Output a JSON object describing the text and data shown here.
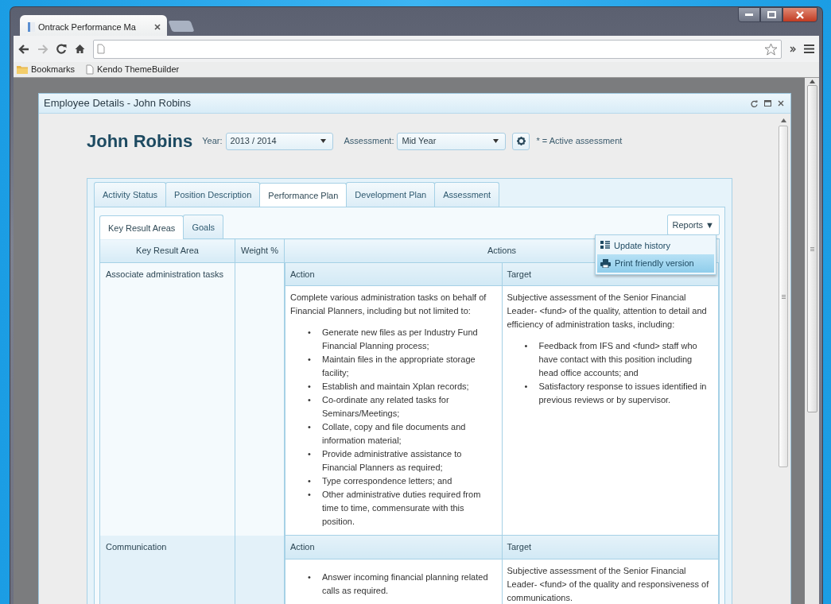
{
  "browser": {
    "tab_title": "Ontrack Performance Ma",
    "bookmarks": [
      {
        "kind": "folder",
        "label": "Bookmarks"
      },
      {
        "kind": "page",
        "label": "Kendo ThemeBuilder"
      }
    ]
  },
  "dialog": {
    "title": "Employee Details - John Robins"
  },
  "employee": {
    "name": "John Robins",
    "year_label": "Year:",
    "year": "2013 / 2014",
    "assessment_label": "Assessment:",
    "assessment": "Mid Year",
    "note": "* = Active assessment"
  },
  "tabs": [
    {
      "label": "Activity Status",
      "selected": false
    },
    {
      "label": "Position Description",
      "selected": false
    },
    {
      "label": "Performance Plan",
      "selected": true
    },
    {
      "label": "Development Plan",
      "selected": false
    },
    {
      "label": "Assessment",
      "selected": false
    }
  ],
  "subtabs": [
    {
      "label": "Key Result Areas",
      "selected": true
    },
    {
      "label": "Goals",
      "selected": false
    }
  ],
  "reports": {
    "label": "Reports",
    "caret": "▼",
    "menu": [
      {
        "kind": "history",
        "label": "Update history",
        "selected": false
      },
      {
        "kind": "print",
        "label": "Print friendly version",
        "selected": true
      }
    ]
  },
  "table": {
    "columns": [
      "Key Result Area",
      "Weight %",
      "Actions"
    ],
    "rows": [
      {
        "area": "Associate administration tasks",
        "sub_columns": [
          "Action",
          "Target"
        ],
        "action": {
          "intro": "Complete various administration tasks on behalf of Financial Planners, including but not limited to:",
          "marker": "•",
          "bullets": [
            "Generate new files as per Industry Fund Financial Planning process;",
            "Maintain files in the appropriate storage facility;",
            "Establish and maintain Xplan records;",
            "Co-ordinate any related tasks for Seminars/Meetings;",
            "Collate, copy and file documents and information material;",
            "Provide administrative assistance to Financial Planners as required;",
            "Type correspondence letters; and",
            "Other administrative duties required from time to time, commensurate with this position."
          ]
        },
        "target": {
          "intro": "Subjective assessment of the Senior Financial Leader- <fund> of the quality, attention to detail and efficiency of administration tasks, including:",
          "marker": "•",
          "bullets": [
            "Feedback from IFS and <fund> staff who have contact with this position including head office accounts; and",
            "Satisfactory response to issues identified in previous reviews or by supervisor."
          ]
        }
      },
      {
        "area": "Communication",
        "sub_columns": [
          "Action",
          "Target"
        ],
        "action": {
          "marker": "•",
          "bullets": [
            "Answer incoming financial planning related calls as required."
          ]
        },
        "target": {
          "intro": "Subjective assessment of the Senior Financial Leader- <fund>  of the quality and responsiveness of communications."
        }
      }
    ]
  }
}
